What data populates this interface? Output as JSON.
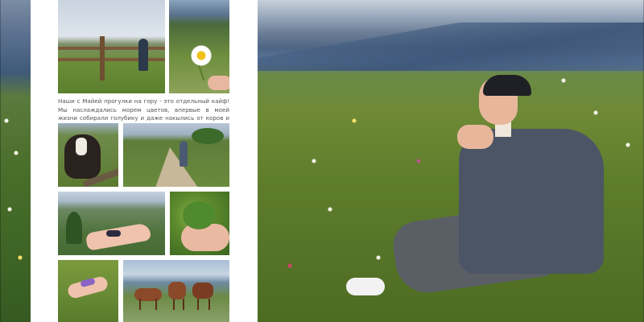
{
  "page": {
    "caption": "Наши с Майей прогулки на гору - это отдельный кайф! Мы наслаждались морем цветов, впервые в моей жизни собирали голубику и даже накылись от коров и лошадей :)"
  },
  "photos": [
    {
      "name": "fence-meadow-photo"
    },
    {
      "name": "daisy-in-hand-photo"
    },
    {
      "name": "cow-photo"
    },
    {
      "name": "hiking-path-photo"
    },
    {
      "name": "blueberries-in-hand-photo"
    },
    {
      "name": "blueberry-bush-photo"
    },
    {
      "name": "flower-bracelet-hand-photo"
    },
    {
      "name": "horses-meadow-photo"
    },
    {
      "name": "woman-in-meadow-photo"
    }
  ]
}
